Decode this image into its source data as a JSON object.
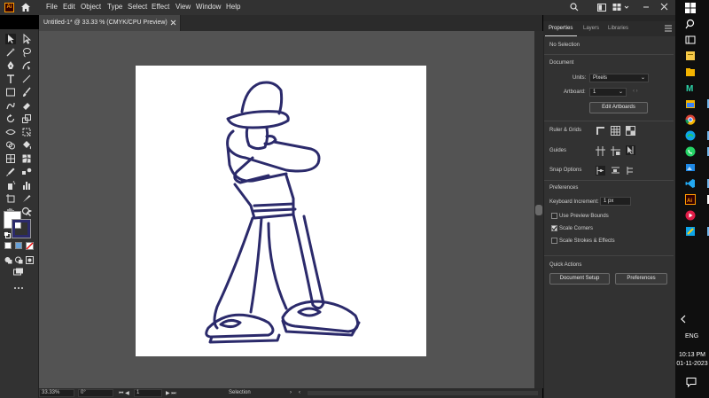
{
  "app": {
    "logo": "Ai",
    "menu": [
      "File",
      "Edit",
      "Object",
      "Type",
      "Select",
      "Effect",
      "View",
      "Window",
      "Help"
    ]
  },
  "document": {
    "tab_title": "Untitled-1* @ 33.33 % (CMYK/CPU Preview)"
  },
  "status": {
    "zoom": "33.33%",
    "rotation": "0°",
    "artboard": "1",
    "tool": "Selection"
  },
  "panel": {
    "tabs": [
      "Properties",
      "Layers",
      "Libraries"
    ],
    "selection": "No Selection",
    "document_heading": "Document",
    "units_label": "Units:",
    "units_value": "Pixels",
    "artboard_label": "Artboard:",
    "artboard_value": "1",
    "edit_artboards": "Edit Artboards",
    "ruler_grids": "Ruler & Grids",
    "guides": "Guides",
    "snap_options": "Snap Options",
    "preferences_heading": "Preferences",
    "keyboard_increment_label": "Keyboard Increment:",
    "keyboard_increment_value": "1 px",
    "use_preview_bounds": "Use Preview Bounds",
    "scale_corners": "Scale Corners",
    "scale_strokes": "Scale Strokes & Effects",
    "quick_actions": "Quick Actions",
    "document_setup": "Document Setup",
    "preferences_button": "Preferences"
  },
  "checkboxes": {
    "use_preview_bounds": false,
    "scale_corners": true,
    "scale_strokes": false
  },
  "taskbar": {
    "language": "ENG",
    "time": "10:13 PM",
    "date": "01-11-2023"
  },
  "colors": {
    "drawing_stroke": "#2b2a6b",
    "app_dark": "#323232",
    "canvas": "#535353"
  }
}
